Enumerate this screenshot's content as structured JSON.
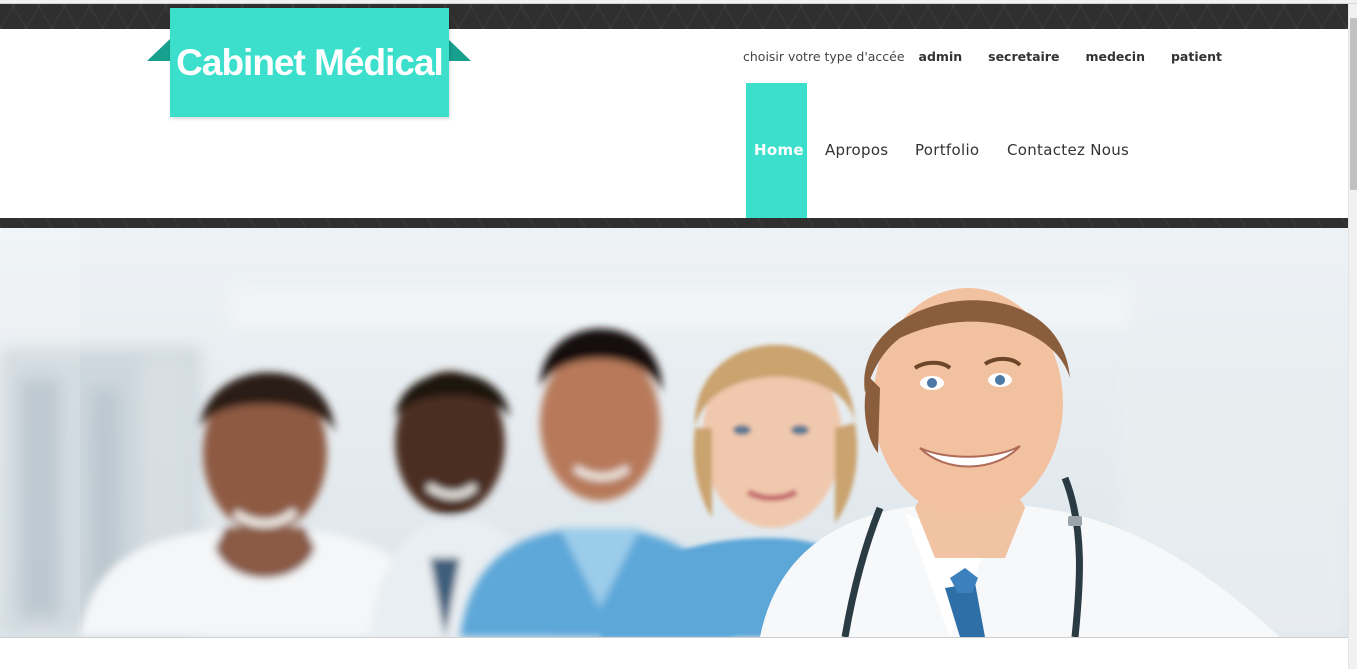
{
  "logo": {
    "title": "Cabinet Médical"
  },
  "access": {
    "label": "choisir votre type d'accée",
    "links": [
      "admin",
      "secretaire",
      "medecin",
      "patient"
    ]
  },
  "nav": {
    "items": [
      "Home",
      "Apropos",
      "Portfolio",
      "Contactez Nous"
    ],
    "active": "Home"
  },
  "colors": {
    "accent": "#3cdfcc",
    "accent_dark": "#16a08d",
    "dark_strip": "#2f2f2f",
    "text": "#333333"
  },
  "hero": {
    "image": "smiling medical team of doctors and nurses"
  }
}
